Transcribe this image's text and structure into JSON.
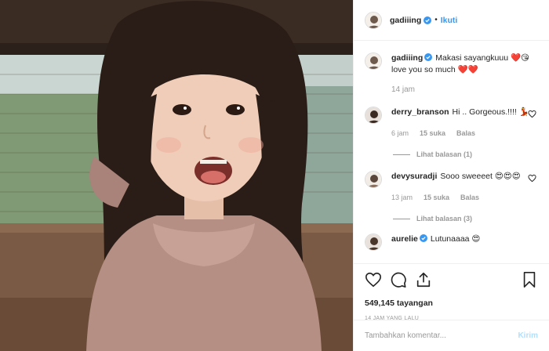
{
  "header": {
    "username": "gadiiing",
    "separator": "•",
    "follow_label": "Ikuti"
  },
  "caption": {
    "username": "gadiiing",
    "text": "Makasi sayangkuuu ❤️😘 love you so much ❤️❤️",
    "time": "14 jam"
  },
  "comments": [
    {
      "username": "derry_branson",
      "text": "Hi .. Gorgeous.!!!! 💃",
      "time": "6 jam",
      "likes": "15 suka",
      "reply": "Balas",
      "view_replies": "Lihat balasan (1)"
    },
    {
      "username": "devysuradji",
      "text": "Sooo sweeeet 😍😍😍",
      "time": "13 jam",
      "likes": "15 suka",
      "reply": "Balas",
      "view_replies": "Lihat balasan (3)"
    },
    {
      "username": "aurelie",
      "text": "Lutunaaaa 😍",
      "time": "",
      "likes": "",
      "reply": "",
      "view_replies": ""
    }
  ],
  "stats": {
    "views": "549,145 tayangan",
    "posted": "14 JAM YANG LALU"
  },
  "composer": {
    "placeholder": "Tambahkan komentar...",
    "send_label": "Kirim"
  },
  "colors": {
    "link_blue": "#3897f0",
    "verified_blue": "#3897f0",
    "muted_text": "#999999",
    "heart_red": "#ed4956",
    "send_disabled": "#b2dffc"
  },
  "icons": [
    "heart-icon",
    "comment-icon",
    "share-icon",
    "bookmark-icon",
    "verified-icon",
    "comment-like-icon"
  ]
}
